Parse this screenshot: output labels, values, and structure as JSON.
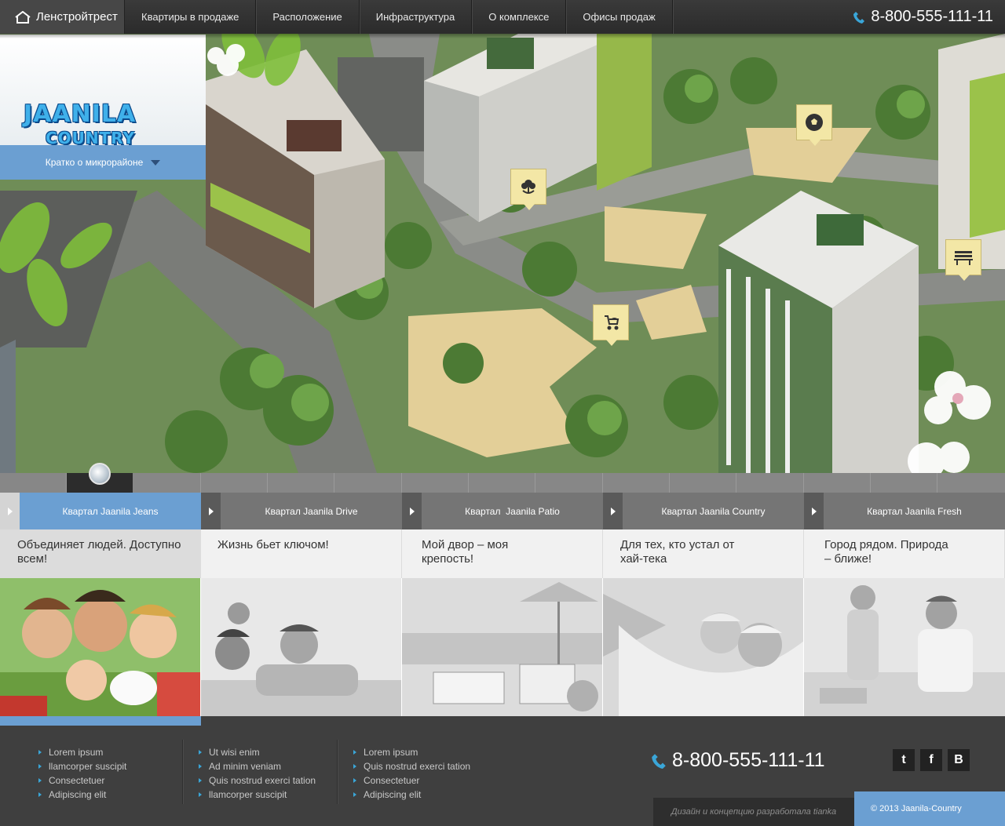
{
  "nav": {
    "brand": "Ленстройтрест",
    "items": [
      "Квартиры в продаже",
      "Расположение",
      "Инфраструктура",
      "О комплексе",
      "Офисы продаж"
    ],
    "phone": "8-800-555-111-11"
  },
  "hero": {
    "logo_line1": "JAANILA",
    "logo_line2": "COUNTRY",
    "brief_label": "Кратко о микрорайоне",
    "pins": [
      "flower-icon",
      "soccer-ball-icon",
      "bench-icon",
      "stroller-icon"
    ]
  },
  "tabs": [
    {
      "label": "Квартал Jaanila Jeans",
      "text": "Объединяет людей. Доступно всем!"
    },
    {
      "label": "Квартал Jaanila Drive",
      "text": "Жизнь бьет ключом!"
    },
    {
      "label": "Квартал  Jaanila Patio",
      "text": "Мой двор – моя крепость!"
    },
    {
      "label": "Квартал Jaanila Country",
      "text": "Для тех, кто устал от хай-тека"
    },
    {
      "label": "Квартал Jaanila Fresh",
      "text": "Город рядом. Природа – ближе!"
    }
  ],
  "footer": {
    "list1": [
      "Lorem ipsum",
      "llamcorper suscipit",
      "Consectetuer",
      "Adipiscing elit"
    ],
    "list2": [
      "Ut wisi enim",
      "Ad minim veniam",
      "Quis nostrud exerci tation",
      "llamcorper suscipit"
    ],
    "list3": [
      "Lorem ipsum",
      "Quis nostrud exerci tation",
      "Consectetuer",
      "Adipiscing elit"
    ],
    "phone": "8-800-555-111-11",
    "social": [
      "twitter-icon",
      "facebook-icon",
      "vkontakte-icon"
    ],
    "credit": "Дизайн и концепцию разработала tianka",
    "copyright": "© 2013 Jaanila-Country"
  },
  "colors": {
    "accent_blue": "#6b9fd2",
    "phone_icon": "#3aa6d8",
    "pin_bg": "#f3e7a6"
  }
}
